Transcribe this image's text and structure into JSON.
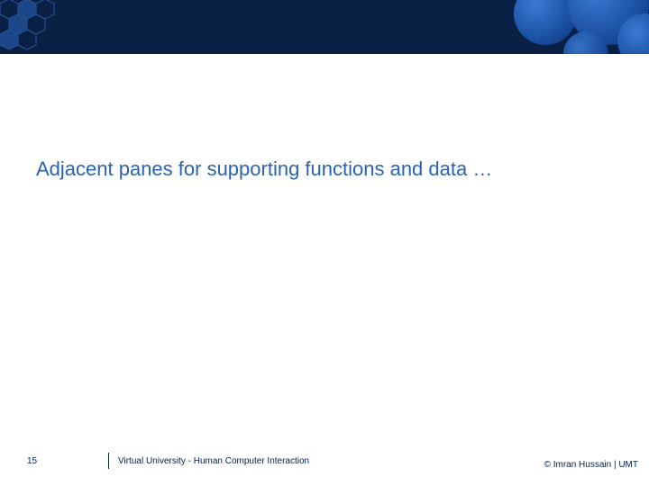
{
  "slide": {
    "title": "Adjacent panes for supporting functions and data …"
  },
  "footer": {
    "page_number": "15",
    "center_text": "Virtual University - Human Computer Interaction",
    "right_text": "© Imran Hussain | UMT"
  }
}
